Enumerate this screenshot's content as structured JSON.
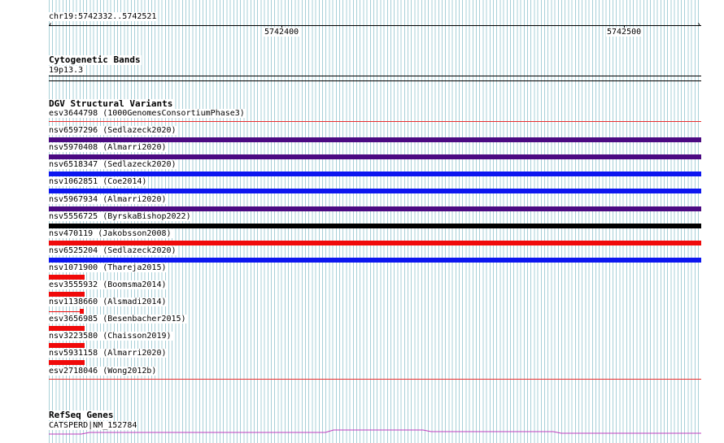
{
  "ruler": {
    "position_label": "chr19:5742332..5742521",
    "tick_labels": [
      "5742400",
      "5742500"
    ]
  },
  "tracks": {
    "cytoband": {
      "title": "Cytogenetic Bands",
      "band_label": "19p13.3"
    },
    "dgv": {
      "title": "DGV Structural Variants",
      "variants": [
        {
          "label": "esv3644798 (1000GenomesConsortiumPhase3)",
          "color": "#e83030",
          "style": "thin",
          "extent": "full"
        },
        {
          "label": "nsv6597296 (Sedlazeck2020)",
          "color": "#4b0a82",
          "style": "thick",
          "extent": "full"
        },
        {
          "label": "nsv5970408 (Almarri2020)",
          "color": "#4b0a82",
          "style": "thick",
          "extent": "full"
        },
        {
          "label": "nsv6518347 (Sedlazeck2020)",
          "color": "#0c16f0",
          "style": "thick",
          "extent": "full"
        },
        {
          "label": "nsv1062851 (Coe2014)",
          "color": "#0c16f0",
          "style": "thick",
          "extent": "full"
        },
        {
          "label": "nsv5967934 (Almarri2020)",
          "color": "#4b0a82",
          "style": "thick",
          "extent": "full"
        },
        {
          "label": "nsv5556725 (ByrskaBishop2022)",
          "color": "#000000",
          "style": "thick",
          "extent": "full"
        },
        {
          "label": "nsv470119 (Jakobsson2008)",
          "color": "#f00a0a",
          "style": "thick",
          "extent": "full"
        },
        {
          "label": "nsv6525204 (Sedlazeck2020)",
          "color": "#0c16f0",
          "style": "thick",
          "extent": "full"
        },
        {
          "label": "nsv1071900 (Thareja2015)",
          "color": "#f00a0a",
          "style": "thick",
          "extent": "short"
        },
        {
          "label": "esv3555932 (Boomsma2014)",
          "color": "#f00a0a",
          "style": "thick",
          "extent": "short"
        },
        {
          "label": "nsv1138660 (Alsmadi2014)",
          "color": "#f00a0a",
          "style": "split",
          "extent": "short"
        },
        {
          "label": "esv3656985 (Besenbacher2015)",
          "color": "#f00a0a",
          "style": "thick",
          "extent": "short"
        },
        {
          "label": "nsv3223580 (Chaisson2019)",
          "color": "#f00a0a",
          "style": "thick",
          "extent": "short"
        },
        {
          "label": "nsv5931158 (Almarri2020)",
          "color": "#f00a0a",
          "style": "thick",
          "extent": "short"
        },
        {
          "label": "esv2718046 (Wong2012b)",
          "color": "#e83030",
          "style": "thin",
          "extent": "full"
        }
      ]
    },
    "refseq": {
      "title": "RefSeq Genes",
      "gene_label": "CATSPERD|NM_152784",
      "color": "#c040c0"
    }
  }
}
